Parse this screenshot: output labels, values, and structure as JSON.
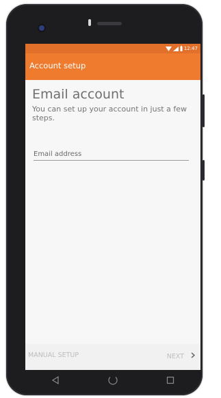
{
  "status_bar": {
    "time": "12:47",
    "icons": [
      "wifi-icon",
      "signal-icon",
      "battery-icon"
    ]
  },
  "app_bar": {
    "title": "Account setup"
  },
  "main": {
    "heading": "Email account",
    "subtext": "You can set up your account in just a few steps.",
    "email_field": {
      "placeholder": "Email address",
      "value": ""
    }
  },
  "bottom_bar": {
    "manual_setup_label": "MANUAL SETUP",
    "next_label": "NEXT"
  },
  "nav_bar": {
    "icons": [
      "back-icon",
      "home-icon",
      "recents-icon"
    ]
  },
  "colors": {
    "accent": "#ee7b2e",
    "status_bar": "#e2702a",
    "disabled_text": "#bdbdbd"
  }
}
